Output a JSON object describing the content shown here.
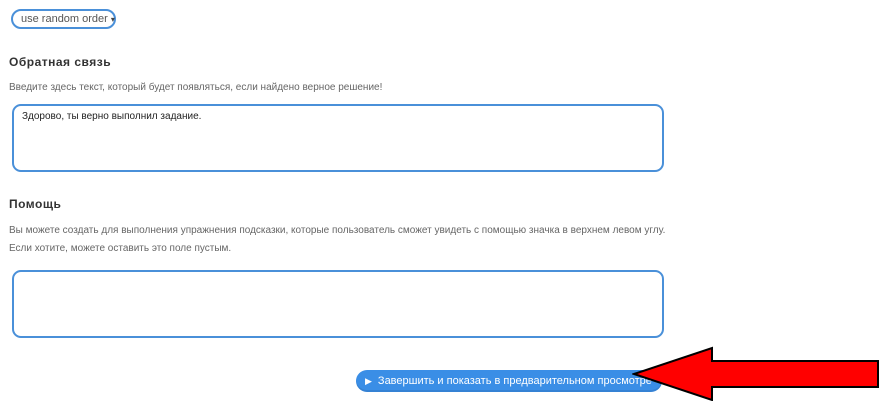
{
  "order_select": {
    "value": "use random order",
    "caret": "▾"
  },
  "feedback": {
    "title": "Обратная связь",
    "hint": "Введите здесь текст, который будет появляться, если найдено верное решение!",
    "value": "Здорово, ты верно выполнил задание."
  },
  "help": {
    "title": "Помощь",
    "hint_line1": "Вы можете создать для выполнения упражнения подсказки, которые пользователь сможет увидеть с помощью значка в верхнем левом углу.",
    "hint_line2": "Если хотите, можете оставить это поле пустым.",
    "value": ""
  },
  "finish_button": {
    "icon": "play-icon",
    "label": "Завершить и показать в предварительном просмотре"
  },
  "colors": {
    "accent": "#4a90d9",
    "button": "#3a8ee6",
    "annotation_arrow": "#ff0000"
  }
}
